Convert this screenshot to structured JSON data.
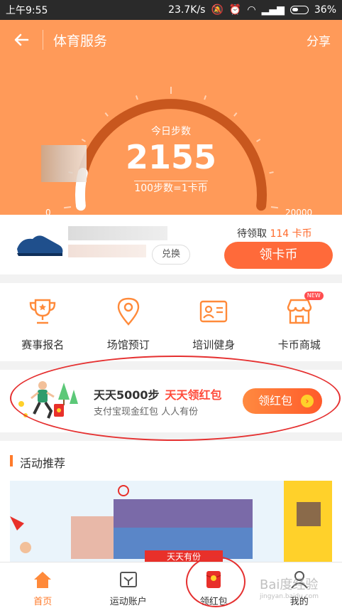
{
  "status_bar": {
    "time": "上午9:55",
    "speed": "23.7K/s",
    "battery": "36%"
  },
  "nav": {
    "title": "体育服务",
    "share": "分享"
  },
  "gauge": {
    "today_label": "今日步数",
    "steps": "2155",
    "rate": "100步数=1卡币",
    "min": "0",
    "max": "20000",
    "progress": 0.1078
  },
  "claim": {
    "pending_label": "待领取",
    "pending_amount": "114 卡币",
    "exchange": "兑换",
    "button": "领卡币"
  },
  "services": [
    {
      "label": "赛事报名",
      "icon": "trophy-icon"
    },
    {
      "label": "场馆预订",
      "icon": "location-pin-icon"
    },
    {
      "label": "培训健身",
      "icon": "id-card-icon"
    },
    {
      "label": "卡币商城",
      "icon": "shop-icon",
      "badge": "NEW"
    }
  ],
  "promo": {
    "title": "天天5000步",
    "highlight": "天天领红包",
    "subtitle": "支付宝现金红包 人人有份",
    "button": "领红包"
  },
  "activity": {
    "title": "活动推荐",
    "banner_text": "天天有份"
  },
  "tabs": [
    {
      "label": "首页",
      "icon": "home-icon",
      "active": true
    },
    {
      "label": "运动账户",
      "icon": "account-icon",
      "active": false
    },
    {
      "label": "领红包",
      "icon": "red-envelope-icon",
      "active": false
    },
    {
      "label": "我的",
      "icon": "user-icon",
      "active": false
    }
  ],
  "watermark": {
    "text": "Bai度经验",
    "sub": "jingyan.baidu.com"
  },
  "colors": {
    "accent": "#ff9a59",
    "button": "#ff6a3a",
    "gauge_arc": "#c8571e"
  }
}
